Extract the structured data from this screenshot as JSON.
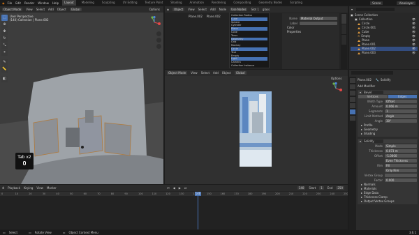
{
  "topbar": {
    "menus": [
      "File",
      "Edit",
      "Render",
      "Window",
      "Help"
    ],
    "workspaces": [
      "Layout",
      "Modeling",
      "Sculpting",
      "UV Editing",
      "Texture Paint",
      "Shading",
      "Animation",
      "Rendering",
      "Compositing",
      "Geometry Nodes",
      "Scripting"
    ],
    "active_workspace": "Layout",
    "scene": "Scene",
    "view_layer": "ViewLayer"
  },
  "viewport": {
    "mode": "Object Mode",
    "menus": [
      "View",
      "Select",
      "Add",
      "Object"
    ],
    "transform": "Global",
    "options": "Options",
    "view_name": "User Perspective",
    "collection_info": "(140) Collection | Plane.002",
    "overlay_text": "Tab x2"
  },
  "shader": {
    "object_mode": "Object",
    "menus": [
      "View",
      "Select",
      "Add",
      "Node"
    ],
    "use_nodes": "Use Nodes",
    "slot": "Slot 1",
    "material": "glass",
    "tabs": [
      "Plane.002",
      "Plane.002"
    ],
    "popup_items": [
      "Collection Radius",
      "Cube",
      "Sphere",
      "Cylinder",
      "Plane",
      "Cone",
      "Torus",
      "Geometry",
      "Grid",
      "Monkey",
      "Circle",
      "Text",
      "Empty",
      "Light",
      "Camera",
      "Collection Instance"
    ],
    "sidebar": {
      "name_label": "Name",
      "name_value": "Material Output",
      "label_label": "Label",
      "color_label": "Color",
      "properties_label": "Properties"
    }
  },
  "render_view": {
    "mode": "Object Mode",
    "menus": [
      "View",
      "Select",
      "Add",
      "Object"
    ],
    "transform": "Global",
    "options": "Options"
  },
  "timeline": {
    "menus": [
      "Playback",
      "Keying",
      "View",
      "Marker"
    ],
    "current_frame": "140",
    "start": "1",
    "end": "250",
    "start_label": "Start",
    "end_label": "End",
    "ticks": [
      "0",
      "10",
      "20",
      "30",
      "40",
      "50",
      "60",
      "70",
      "80",
      "90",
      "100",
      "110",
      "120",
      "130",
      "140",
      "150",
      "160",
      "170",
      "180",
      "190",
      "200",
      "210",
      "220",
      "230",
      "240",
      "250"
    ]
  },
  "statusbar": {
    "items": [
      "Select",
      "Rotate View",
      "Object Context Menu"
    ],
    "version": "3.6.1"
  },
  "outliner": {
    "title": "Scene Collection",
    "rows": [
      {
        "name": "Collection",
        "kind": "collection",
        "selected": false
      },
      {
        "name": "Circle",
        "kind": "mesh",
        "selected": false
      },
      {
        "name": "Circle.001",
        "kind": "mesh",
        "selected": false
      },
      {
        "name": "Cube",
        "kind": "mesh",
        "selected": false
      },
      {
        "name": "Empty",
        "kind": "empty",
        "selected": false
      },
      {
        "name": "Plane",
        "kind": "mesh",
        "selected": false
      },
      {
        "name": "Plane.001",
        "kind": "mesh",
        "selected": false
      },
      {
        "name": "Plane.002",
        "kind": "mesh",
        "selected": true
      },
      {
        "name": "Plane.003",
        "kind": "mesh",
        "selected": false
      }
    ]
  },
  "properties": {
    "object": "Plane.002",
    "modifier_name": "Solidify",
    "add_modifier": "Add Modifier",
    "bevel": {
      "name": "Bevel",
      "tabs": [
        "Vertices",
        "Edges"
      ],
      "rows": [
        {
          "label": "Width Type",
          "value": "Offset"
        },
        {
          "label": "Amount",
          "value": "0.066 m"
        },
        {
          "label": "Segments",
          "value": "1"
        },
        {
          "label": "Limit Method",
          "value": "Angle"
        },
        {
          "label": "Angle",
          "value": "30°"
        }
      ],
      "sections": [
        "Profile",
        "Geometry",
        "Shading"
      ]
    },
    "solidify": {
      "name": "Solidify",
      "rows": [
        {
          "label": "Mode",
          "value": "Simple"
        },
        {
          "label": "Thickness",
          "value": "0.073 m"
        },
        {
          "label": "Offset",
          "value": "-1.0000"
        },
        {
          "label": "",
          "value": "Even Thickness"
        },
        {
          "label": "Rim",
          "value": "Fill"
        },
        {
          "label": "",
          "value": "Only Rim"
        },
        {
          "label": "Vertex Group",
          "value": ""
        },
        {
          "label": "Factor",
          "value": "0.000"
        }
      ],
      "sections": [
        "Normals",
        "Materials",
        "Edge Data",
        "Thickness Clamp",
        "Output Vertex Groups"
      ]
    }
  },
  "colors": {
    "accent": "#4772b3",
    "header": "#2b2b2b",
    "viewport_bg": "#3d3d3d",
    "render_bg": "#303030",
    "playhead": "#4772b3"
  }
}
